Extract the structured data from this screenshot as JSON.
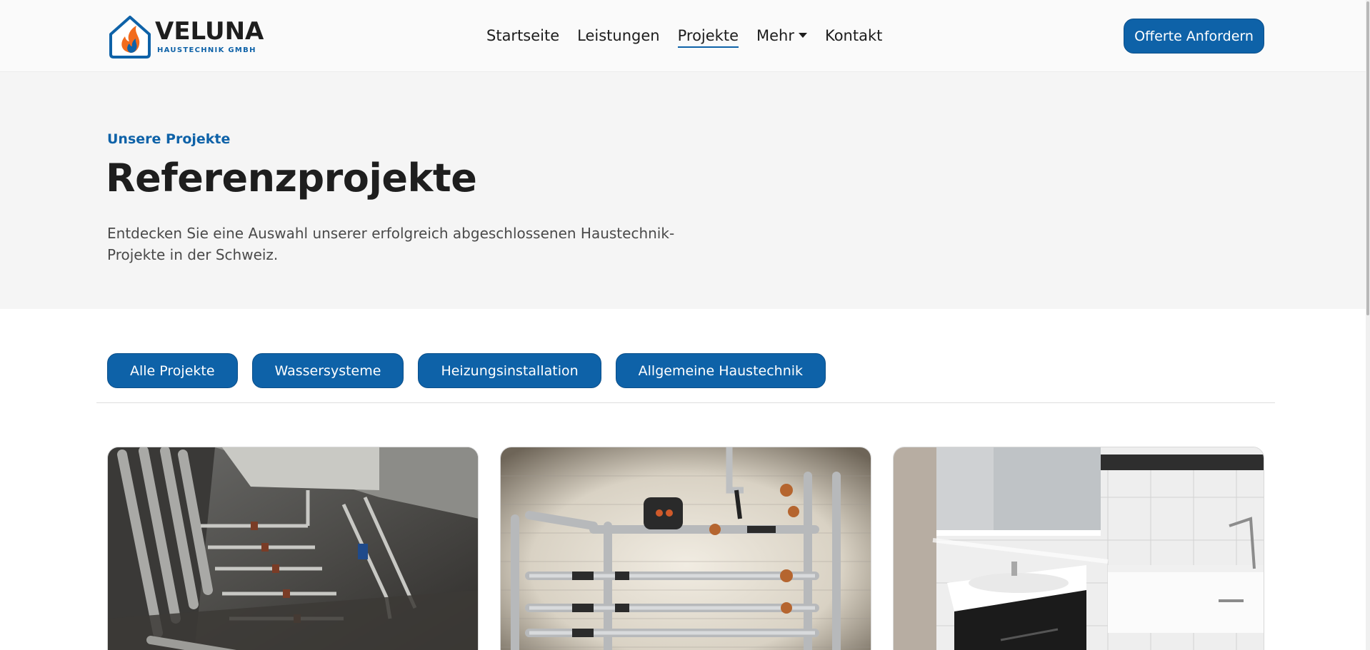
{
  "header": {
    "logo": {
      "name": "VELUNA",
      "subtitle": "HAUSTECHNIK GMBH"
    },
    "nav": [
      {
        "label": "Startseite"
      },
      {
        "label": "Leistungen"
      },
      {
        "label": "Projekte",
        "active": true
      },
      {
        "label": "Mehr",
        "dropdown": true
      },
      {
        "label": "Kontakt"
      }
    ],
    "cta_label": "Offerte Anfordern"
  },
  "hero": {
    "eyebrow": "Unsere Projekte",
    "title": "Referenzprojekte",
    "text": "Entdecken Sie eine Auswahl unserer erfolgreich abgeschlossenen Haustechnik-Projekte in der Schweiz."
  },
  "filters": [
    {
      "label": "Alle Projekte"
    },
    {
      "label": "Wassersysteme"
    },
    {
      "label": "Heizungsinstallation"
    },
    {
      "label": "Allgemeine Haustechnik"
    }
  ],
  "projects": [
    {
      "image": "basement-pipe-installation-photo"
    },
    {
      "image": "heating-distribution-pipes-photo"
    },
    {
      "image": "modern-bathroom-washbasin-photo"
    }
  ],
  "colors": {
    "brand_blue": "#0e62a8",
    "brand_orange": "#f26b1d",
    "hero_background": "#f5f5f5",
    "text_dark": "#1e1e1e"
  }
}
